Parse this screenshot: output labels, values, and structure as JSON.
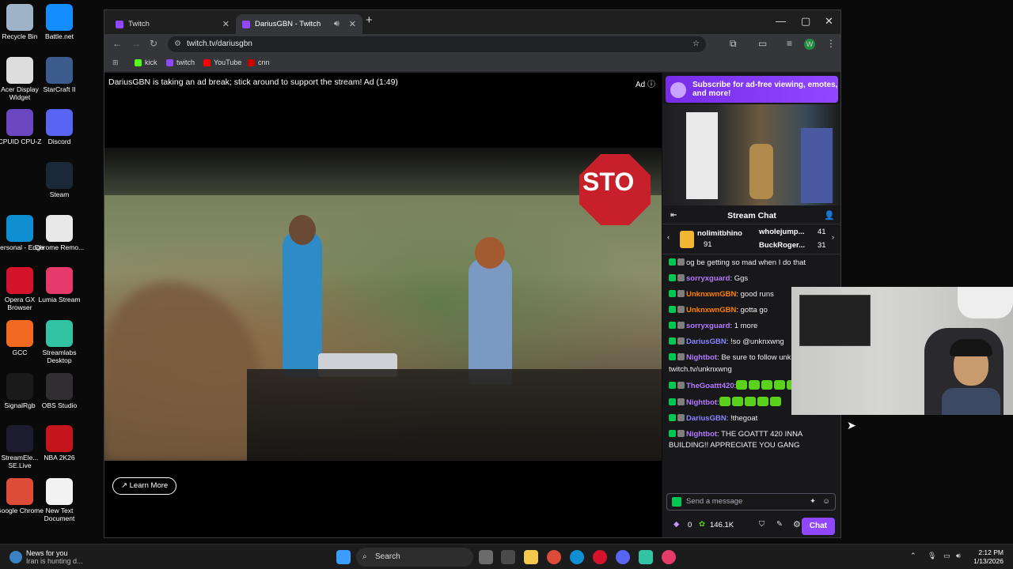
{
  "desktop": {
    "icons": [
      {
        "label": "Recycle Bin",
        "color": "#9fb3c8"
      },
      {
        "label": "Battle.net",
        "color": "#148eff"
      },
      {
        "label": "Acer Display Widget",
        "color": "#dddddd"
      },
      {
        "label": "StarCraft II",
        "color": "#3b5c8c"
      },
      {
        "label": "CPUID CPU-Z",
        "color": "#6b46c1"
      },
      {
        "label": "Discord",
        "color": "#5865f2"
      },
      {
        "label": "Steam",
        "color": "#1b2838"
      },
      {
        "label": "Personal - Edge",
        "color": "#0f8ed1"
      },
      {
        "label": "Chrome Remo...",
        "color": "#e8e8e8"
      },
      {
        "label": "Opera GX Browser",
        "color": "#d5142b"
      },
      {
        "label": "Lumia Stream",
        "color": "#e63b6a"
      },
      {
        "label": "GCC",
        "color": "#f26a22"
      },
      {
        "label": "Streamlabs Desktop",
        "color": "#31c3a2"
      },
      {
        "label": "SignalRgb",
        "color": "#1a1a1a"
      },
      {
        "label": "OBS Studio",
        "color": "#302e31"
      },
      {
        "label": "StreamEle... SE.Live",
        "color": "#1c1c2e"
      },
      {
        "label": "NBA 2K26",
        "color": "#c4161c"
      },
      {
        "label": "Google Chrome",
        "color": "#dd4b39"
      },
      {
        "label": "New Text Document",
        "color": "#f2f2f2"
      }
    ]
  },
  "browser": {
    "tabs": [
      {
        "title": "Twitch"
      },
      {
        "title": "DariusGBN - Twitch"
      }
    ],
    "url": "twitch.tv/dariusgbn",
    "bookmarks": [
      {
        "label": "kick",
        "color": "#53fc18"
      },
      {
        "label": "twitch",
        "color": "#9146ff"
      },
      {
        "label": "YouTube",
        "color": "#ff0000"
      },
      {
        "label": "cnn",
        "color": "#cc0000"
      }
    ]
  },
  "player": {
    "ad_message": "DariusGBN is taking an ad break; stick around to support the stream! Ad (1:49)",
    "ad_label": "Ad",
    "learn_more": "Learn More",
    "stop_sign": "STO"
  },
  "sidebar": {
    "sub_banner": "Subscribe for ad-free viewing, emotes, and more!",
    "chat_title": "Stream Chat",
    "leaderboard": [
      {
        "name": "nolimitbhino",
        "count": "91"
      },
      {
        "name": "wholejump...",
        "count": "41"
      },
      {
        "name": "BuckRoger...",
        "count": "31"
      }
    ],
    "messages": [
      {
        "user": "",
        "color": "#ff4a4a",
        "text": "og be getting so mad when I do that"
      },
      {
        "user": "sorryxguard",
        "color": "#b57aff",
        "text": ": Ggs"
      },
      {
        "user": "UnknxwnGBN",
        "color": "#ff7f00",
        "text": ": good runs"
      },
      {
        "user": "UnknxwnGBN",
        "color": "#ff7f00",
        "text": ": gotta go"
      },
      {
        "user": "sorryxguard",
        "color": "#b57aff",
        "text": ": 1 more"
      },
      {
        "user": "DariusGBN",
        "color": "#8a84ff",
        "text": ": !so @unknxwng"
      },
      {
        "user": "Nightbot",
        "color": "#b57aff",
        "text": ": Be sure to follow unknxwngbn at twitch.tv/unknxwng"
      },
      {
        "user": "TheGoattt420",
        "color": "#b57aff",
        "text": ":"
      },
      {
        "user": "Nightbot",
        "color": "#b57aff",
        "text": ":"
      },
      {
        "user": "DariusGBN",
        "color": "#8a84ff",
        "text": ": !thegoat"
      },
      {
        "user": "Nightbot",
        "color": "#b57aff",
        "text": ": THE GOATTT 420 INNA BUILDING!! APPRECIATE YOU GANG"
      }
    ],
    "input_placeholder": "Send a message",
    "points_zero": "0",
    "points_total": "146.1K",
    "chat_button": "Chat"
  },
  "taskbar": {
    "news_title": "News for you",
    "news_sub": "Iran is hunting d...",
    "search": "Search",
    "time": "2:12 PM",
    "date": "1/13/2026"
  }
}
